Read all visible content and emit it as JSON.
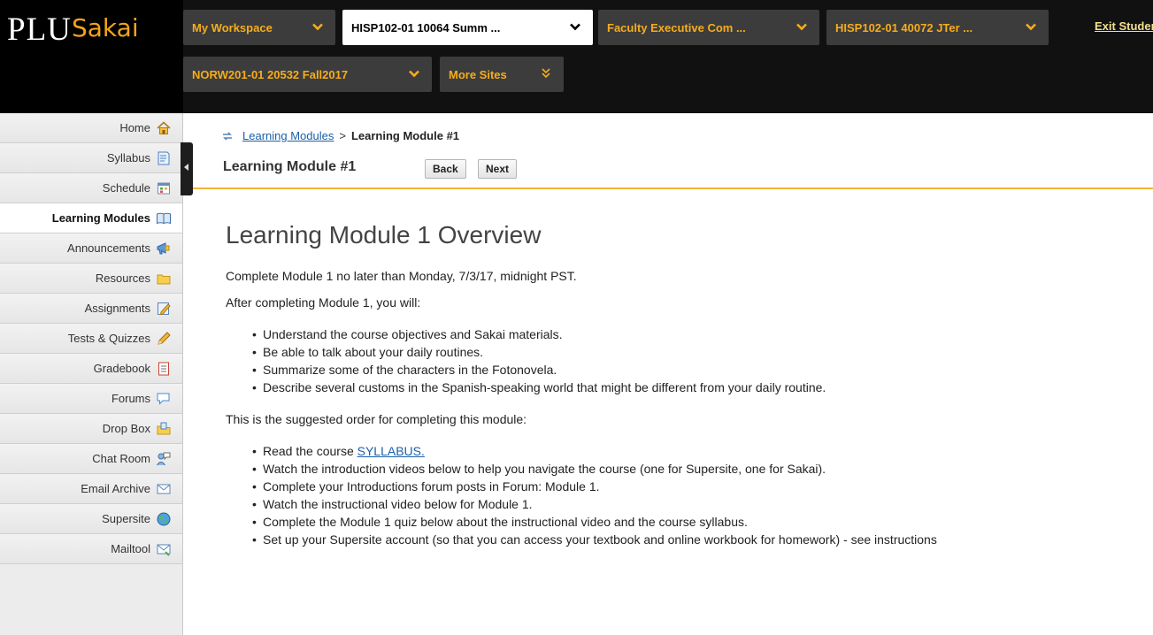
{
  "header": {
    "logo_plu": "PLU",
    "logo_sakai": "Sakai",
    "exit_link": "Exit Studer",
    "site_tabs": [
      {
        "label": "My Workspace",
        "chevron": "chevron-down-icon"
      },
      {
        "label": "HISP102-01 10064 Summ ...",
        "chevron": "chevron-down-icon"
      },
      {
        "label": "Faculty Executive Com ...",
        "chevron": "chevron-down-icon"
      },
      {
        "label": "HISP102-01 40072 JTer ...",
        "chevron": "chevron-down-icon"
      },
      {
        "label": "NORW201-01 20532 Fall2017",
        "chevron": "chevron-down-icon"
      },
      {
        "label": "More Sites",
        "chevron": "double-chevron-down-icon"
      }
    ]
  },
  "toolmenu": {
    "items": [
      {
        "label": "Home",
        "icon": "home-icon"
      },
      {
        "label": "Syllabus",
        "icon": "syllabus-icon"
      },
      {
        "label": "Schedule",
        "icon": "calendar-icon"
      },
      {
        "label": "Learning Modules",
        "icon": "book-icon",
        "active": true
      },
      {
        "label": "Announcements",
        "icon": "megaphone-icon"
      },
      {
        "label": "Resources",
        "icon": "folder-icon"
      },
      {
        "label": "Assignments",
        "icon": "assignment-icon"
      },
      {
        "label": "Tests & Quizzes",
        "icon": "pencil-icon"
      },
      {
        "label": "Gradebook",
        "icon": "gradebook-icon"
      },
      {
        "label": "Forums",
        "icon": "speech-bubble-icon"
      },
      {
        "label": "Drop Box",
        "icon": "dropbox-icon"
      },
      {
        "label": "Chat Room",
        "icon": "chat-icon"
      },
      {
        "label": "Email Archive",
        "icon": "envelope-icon"
      },
      {
        "label": "Supersite",
        "icon": "globe-icon"
      },
      {
        "label": "Mailtool",
        "icon": "mail-icon"
      }
    ]
  },
  "breadcrumb": {
    "link": "Learning Modules",
    "separator": ">",
    "current": "Learning Module #1"
  },
  "page": {
    "title": "Learning Module #1",
    "back_label": "Back",
    "next_label": "Next"
  },
  "content": {
    "heading": "Learning Module 1 Overview",
    "intro": "Complete Module 1 no later than  Monday,  7/3/17, midnight PST.",
    "lead1": "After completing Module 1, you will:",
    "objectives": [
      "Understand the course objectives and Sakai materials.",
      "Be able to talk about your daily routines.",
      "Summarize some of the characters in the Fotonovela.",
      "Describe several customs in the Spanish-speaking world that might be different from your daily routine."
    ],
    "lead2": "This is the suggested order for completing this module:",
    "step1_prefix": "Read the course ",
    "step1_link": "SYLLABUS.",
    "steps": [
      "Watch the introduction videos below to help you navigate the course (one for Supersite, one for Sakai).",
      "Complete your Introductions forum posts in Forum:  Module 1.",
      "Watch the instructional video below for Module 1.",
      "Complete the Module 1 quiz below about the instructional video and the course syllabus.",
      "Set up your Supersite account (so that you can access your textbook and online workbook for homework) - see instructions"
    ]
  }
}
